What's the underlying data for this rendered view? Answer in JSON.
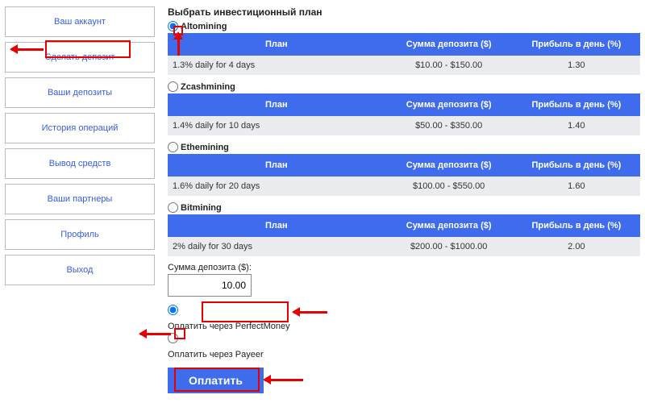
{
  "sidebar": {
    "items": [
      {
        "label": "Ваш аккаунт"
      },
      {
        "label": "Сделать депозит"
      },
      {
        "label": "Ваши депозиты"
      },
      {
        "label": "История операций"
      },
      {
        "label": "Вывод средств"
      },
      {
        "label": "Ваши партнеры"
      },
      {
        "label": "Профиль"
      },
      {
        "label": "Выход"
      }
    ]
  },
  "main": {
    "title": "Выбрать инвестиционный план",
    "columns": {
      "plan": "План",
      "sum": "Сумма депозита ($)",
      "profit": "Прибыль в день (%)"
    },
    "plans": [
      {
        "name": "Altomining",
        "desc": "1.3% daily for 4 days",
        "range": "$10.00 - $150.00",
        "profit": "1.30",
        "selected": true
      },
      {
        "name": "Zcashmining",
        "desc": "1.4% daily for 10 days",
        "range": "$50.00 - $350.00",
        "profit": "1.40",
        "selected": false
      },
      {
        "name": "Ethemining",
        "desc": "1.6% daily for 20 days",
        "range": "$100.00 - $550.00",
        "profit": "1.60",
        "selected": false
      },
      {
        "name": "Bitmining",
        "desc": "2% daily for 30 days",
        "range": "$200.00 - $1000.00",
        "profit": "2.00",
        "selected": false
      }
    ],
    "amount_label": "Сумма депозита ($):",
    "amount_value": "10.00",
    "pay_methods": [
      {
        "label": "Оплатить через PerfectMoney",
        "selected": true
      },
      {
        "label": "Оплатить через Payeer",
        "selected": false
      }
    ],
    "pay_button": "Оплатить"
  }
}
